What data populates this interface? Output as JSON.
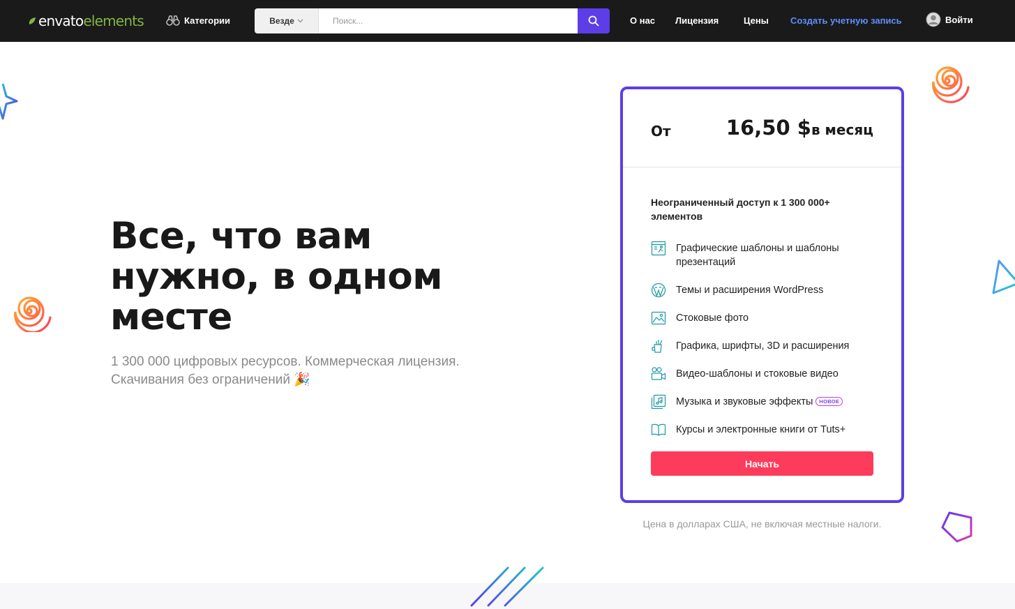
{
  "header": {
    "logo": {
      "part1": "envato",
      "part2": "elements"
    },
    "categories_label": "Категории",
    "search": {
      "scope": "Везде",
      "placeholder": "Поиск..."
    },
    "nav": [
      {
        "label": "О нас"
      },
      {
        "label": "Лицензия"
      },
      {
        "label": "Цены"
      },
      {
        "label": "Создать учетную запись"
      }
    ],
    "login_label": "Войти",
    "accent_color": "#5c3de8"
  },
  "hero": {
    "title": "Все, что вам нужно, в одном месте",
    "subtitle_line1": "1 300 000 цифровых ресурсов. Коммерческая лицензия.",
    "subtitle_line2": "Скачивания без ограничений",
    "subtitle_emoji": "🎉"
  },
  "pricing": {
    "from_label": "От",
    "amount": "16,50 $",
    "period": "в месяц",
    "intro": "Неограниченный доступ к 1 300 000+ элементов",
    "features": [
      {
        "icon": "template-icon",
        "label": "Графические шаблоны и шаблоны презентаций"
      },
      {
        "icon": "wordpress-icon",
        "label": "Темы и расширения WordPress"
      },
      {
        "icon": "photo-icon",
        "label": "Стоковые фото"
      },
      {
        "icon": "graphics-icon",
        "label": "Графика, шрифты, 3D и расширения"
      },
      {
        "icon": "video-icon",
        "label": "Видео-шаблоны и стоковые видео"
      },
      {
        "icon": "music-icon",
        "label": "Музыка и звуковые эффекты",
        "badge": "НОВОЕ"
      },
      {
        "icon": "book-icon",
        "label": "Курсы и электронные книги от Tuts+"
      }
    ],
    "cta_label": "Начать",
    "cta_color": "#fd3c5b",
    "note": "Цена в долларах США, не включая местные налоги."
  }
}
